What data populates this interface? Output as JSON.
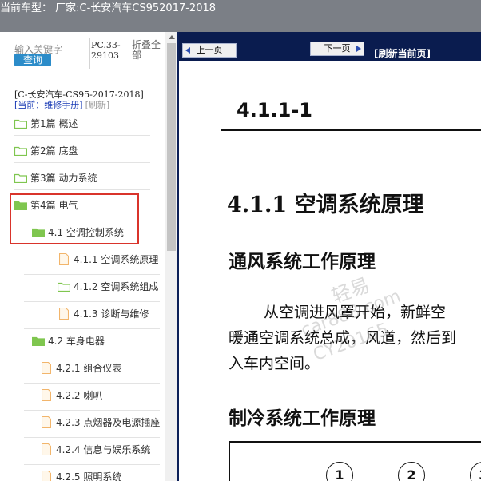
{
  "window": {
    "title": "当前车型： 厂家:C-长安汽车CS952017-2018"
  },
  "search": {
    "placeholder": "输入关键字",
    "button_label": "查询",
    "doc_code": "PC.33-29103",
    "collapse_label": "折叠全部"
  },
  "breadcrumb": {
    "model": "[C-长安汽车-CS95-2017-2018]",
    "current": "[当前：维修手册]",
    "refresh": "[刷新]"
  },
  "tree": [
    {
      "label": "第1篇 概述",
      "icon": "folder-icon"
    },
    {
      "label": "第2篇 底盘",
      "icon": "folder-icon"
    },
    {
      "label": "第3篇 动力系统",
      "icon": "folder-icon"
    },
    {
      "label": "第4篇 电气",
      "icon": "folder-icon"
    },
    {
      "label": "4.1 空调控制系统",
      "icon": "folder-icon"
    },
    {
      "label": "4.1.1 空调系统原理",
      "icon": "file-icon"
    },
    {
      "label": "4.1.2 空调系统组成",
      "icon": "folder-icon"
    },
    {
      "label": "4.1.3 诊断与维修",
      "icon": "file-icon"
    },
    {
      "label": "4.2 车身电器",
      "icon": "folder-icon"
    },
    {
      "label": "4.2.1 组合仪表",
      "icon": "file-icon"
    },
    {
      "label": "4.2.2 喇叭",
      "icon": "file-icon"
    },
    {
      "label": "4.2.3 点烟器及电源插座",
      "icon": "file-icon"
    },
    {
      "label": "4.2.4 信息与娱乐系统",
      "icon": "file-icon"
    },
    {
      "label": "4.2.5 照明系统",
      "icon": "file-icon"
    }
  ],
  "toolbar": {
    "prev_label": "上一页",
    "next_label": "下一页",
    "refresh_label": "[刷新当前页]"
  },
  "document": {
    "page_number": "4.1.1-1",
    "heading": "4.1.1 空调系统原理",
    "section1_title": "通风系统工作原理",
    "para_line1": "从空调进风罩开始，新鲜空",
    "para_line2": "暖通空调系统总成，风道，然后到",
    "para_line3": "入车内空间。",
    "section2_title": "制冷系统工作原理",
    "figure_labels": [
      "1",
      "2",
      "3"
    ],
    "watermark1": "轻易",
    "watermark2": "car888.com",
    "watermark3": "CY20165"
  },
  "colors": {
    "titlebar": "#7b7f86",
    "toolbar": "#0a1c4f",
    "folder": "#7fc64f",
    "file": "#f2b56b",
    "highlight": "#d9342b",
    "search_button": "#2c8cc9",
    "breadcrumb_current": "#1a3bb5"
  }
}
